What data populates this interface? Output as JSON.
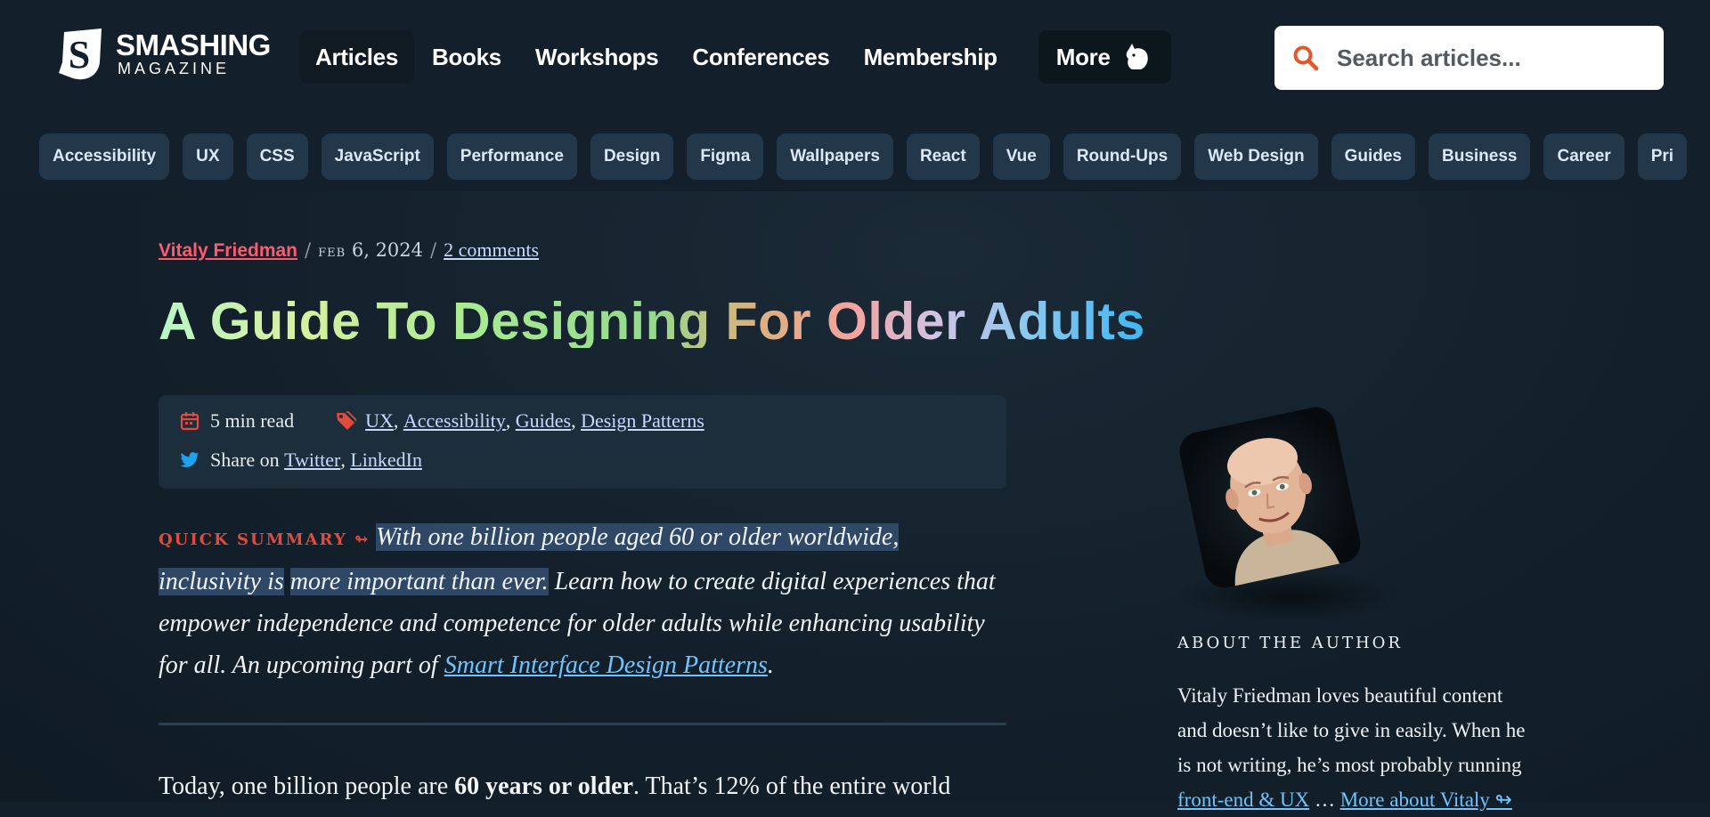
{
  "header": {
    "logo": {
      "word1": "SMASHING",
      "word2": "MAGAZINE"
    },
    "nav": [
      {
        "label": "Articles"
      },
      {
        "label": "Books"
      },
      {
        "label": "Workshops"
      },
      {
        "label": "Conferences"
      },
      {
        "label": "Membership"
      },
      {
        "label": "More"
      }
    ],
    "search": {
      "placeholder": "Search articles..."
    }
  },
  "tags": [
    "Accessibility",
    "UX",
    "CSS",
    "JavaScript",
    "Performance",
    "Design",
    "Figma",
    "Wallpapers",
    "React",
    "Vue",
    "Round-Ups",
    "Web Design",
    "Guides",
    "Business",
    "Career",
    "Pri"
  ],
  "article": {
    "author": "Vitaly Friedman",
    "date_month": "feb",
    "date_rest": "6, 2024",
    "comments": "2 comments",
    "title": "A Guide To Designing For Older Adults",
    "read_time": "5 min read",
    "categories": [
      "UX",
      "Accessibility",
      "Guides",
      "Design Patterns"
    ],
    "share_label": "Share on",
    "share_links": [
      "Twitter",
      "LinkedIn"
    ],
    "summary_label": "QUICK SUMMARY ↬",
    "summary_highlight_1": "With one billion people aged 60 or older worldwide, inclusivity is",
    "summary_highlight_2": "more important than ever.",
    "summary_rest": " Learn how to create digital experiences that empower independence and competence for older adults while enhancing usability for all. An upcoming part of ",
    "summary_link": "Smart Interface Design Patterns",
    "summary_end": ".",
    "body_start": "Today, one billion people are ",
    "body_bold": "60 years or older",
    "body_end": ". That’s 12% of the entire world"
  },
  "sidebar": {
    "about_title": "ABOUT THE AUTHOR",
    "bio_line1": "Vitaly Friedman loves beautiful content",
    "bio_line2": "and doesn’t like to give in easily. When he",
    "bio_line3": "is not writing, he’s most probably running",
    "bio_link": "front-end & UX",
    "bio_tail": " … ",
    "more_link": "More about Vitaly ↬"
  },
  "colors": {
    "background": "#13202b",
    "author_link": "#ff5a6e",
    "summary_label": "#e24a3b",
    "link_blue": "#6ec4ff",
    "tag_bg": "#22374a"
  },
  "icons": [
    "smashing-logo-icon",
    "cat-icon",
    "search-icon",
    "calendar-icon",
    "tag-icon",
    "twitter-icon"
  ]
}
